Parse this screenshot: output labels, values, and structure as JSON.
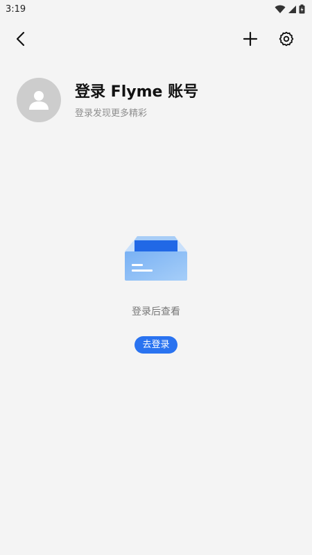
{
  "status_bar": {
    "time": "3:19"
  },
  "header": {
    "back_icon": "chevron-left-icon",
    "add_icon": "plus-icon",
    "settings_icon": "gear-icon"
  },
  "profile": {
    "title": "登录 Flyme 账号",
    "subtitle": "登录发现更多精彩",
    "avatar_icon": "person-icon"
  },
  "empty_state": {
    "message": "登录后查看",
    "button_label": "去登录",
    "illustration_icon": "inbox-box-icon"
  },
  "colors": {
    "background": "#f4f4f4",
    "accent": "#2a73f0",
    "avatar_bg": "#cdcdcd"
  }
}
